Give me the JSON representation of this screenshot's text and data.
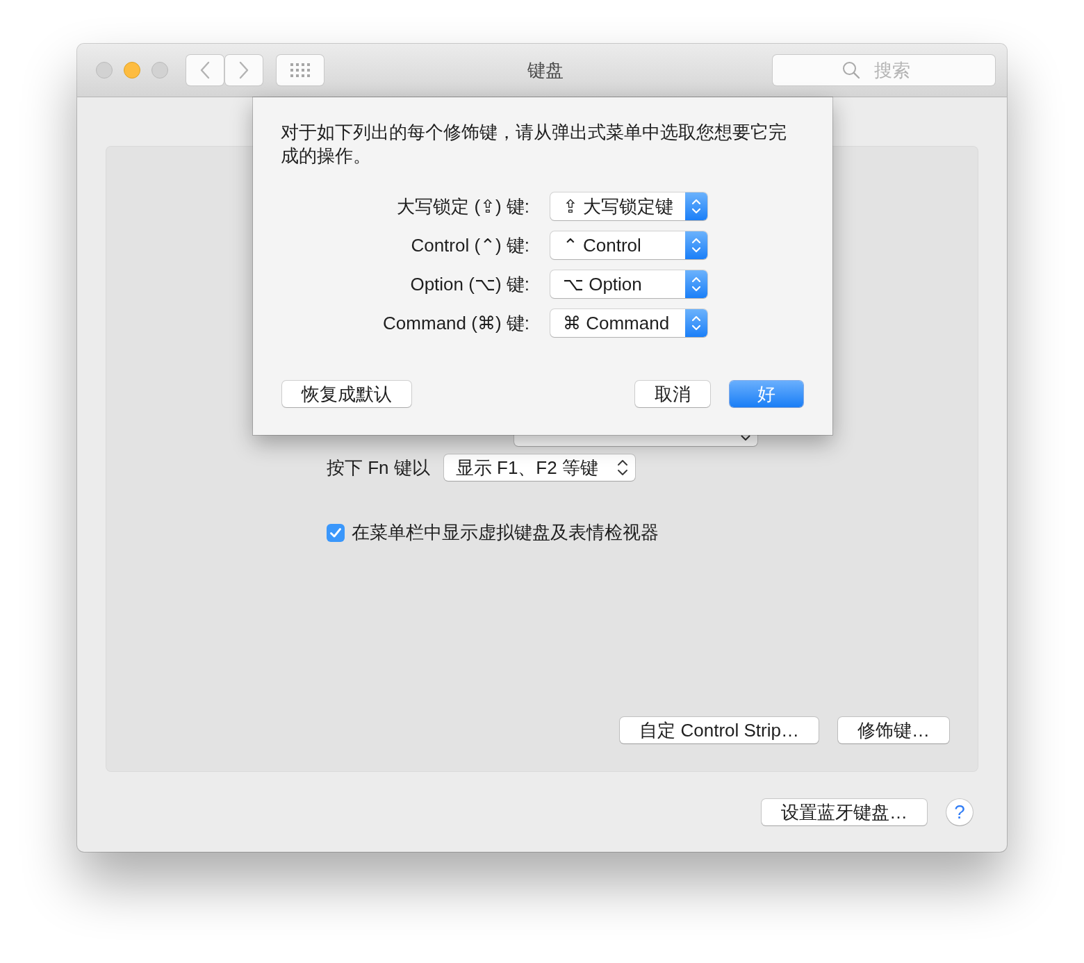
{
  "window": {
    "title": "键盘",
    "buttons": [
      {
        "kind": "close",
        "disabled": true
      },
      {
        "kind": "minimize",
        "disabled": false
      },
      {
        "kind": "zoom",
        "disabled": true
      }
    ],
    "search": {
      "placeholder": "搜索"
    }
  },
  "sheet": {
    "description": "对于如下列出的每个修饰键，请从弹出式菜单中选取您想要它完成的操作。",
    "modifiers": [
      {
        "label": "大写锁定 (⇪) 键:",
        "value": "⇪ 大写锁定键"
      },
      {
        "label": "Control (⌃) 键:",
        "value": "⌃ Control"
      },
      {
        "label": "Option (⌥) 键:",
        "value": "⌥ Option"
      },
      {
        "label": "Command (⌘) 键:",
        "value": "⌘ Command"
      }
    ],
    "buttons": [
      {
        "label": "恢复成默认",
        "kind": "reset"
      },
      {
        "label": "取消",
        "kind": "cancel"
      },
      {
        "label": "好",
        "kind": "default"
      }
    ]
  },
  "panel": {
    "fn_row": {
      "label": "按下 Fn 键以",
      "value": "显示 F1、F2 等键"
    },
    "show_viewer": {
      "label": "在菜单栏中显示虚拟键盘及表情检视器",
      "checked": true
    },
    "buttons": [
      "自定 Control Strip…",
      "修饰键…"
    ]
  },
  "footer": {
    "bluetooth_button": "设置蓝牙键盘…",
    "help_button": "?"
  }
}
